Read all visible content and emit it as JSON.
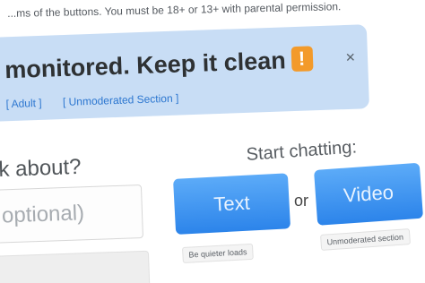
{
  "notice": {
    "terms_text": "...ms of the buttons. You must be 18+ or 13+ with parental permission."
  },
  "banner": {
    "title": "monitored. Keep it clean",
    "warning_glyph": "!",
    "close_glyph": "×",
    "links": [
      {
        "label": "[ Adult ]"
      },
      {
        "label": "[ Unmoderated Section ]"
      }
    ],
    "background_color": "#c8ddf5",
    "warning_color": "#f39a2a"
  },
  "interests": {
    "question": "k about?",
    "placeholder": "optional)"
  },
  "start": {
    "label": "Start chatting:",
    "text_button": "Text",
    "or_text": "or",
    "video_button": "Video",
    "text_sub": "Be quieter loads",
    "video_sub": "Unmoderated section",
    "button_color": "#2c84ea"
  }
}
